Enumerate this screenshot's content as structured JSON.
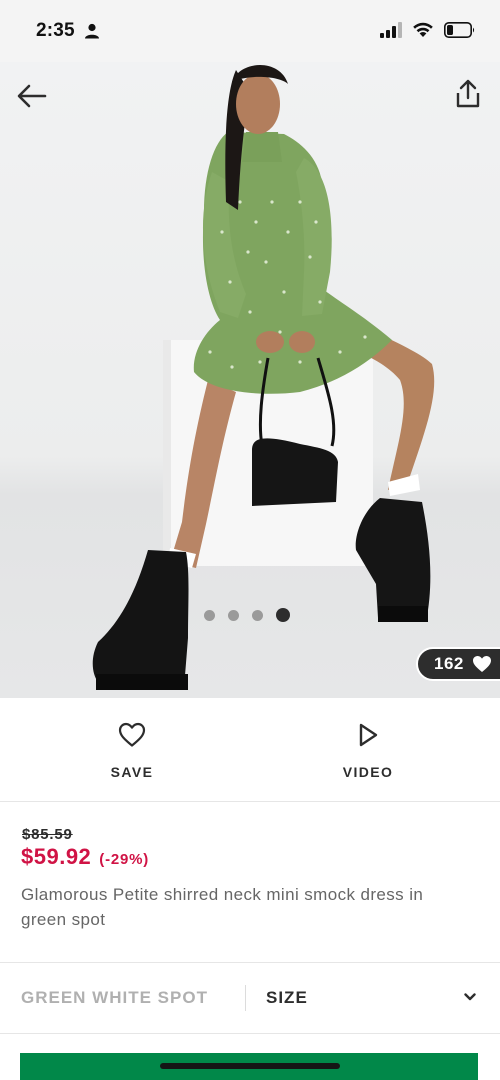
{
  "status_bar": {
    "time": "2:35"
  },
  "product": {
    "image_dots": 4,
    "active_dot": 4,
    "likes": "162",
    "actions": {
      "save_label": "SAVE",
      "video_label": "VIDEO"
    },
    "was_price": "$85.59",
    "now_price": "$59.92",
    "discount": "(-29%)",
    "name": "Glamorous Petite shirred neck mini smock dress in green spot",
    "colour": "GREEN WHITE SPOT",
    "size_label": "SIZE"
  },
  "colors": {
    "sale_price": "#d01345",
    "add_to_bag": "#018849",
    "text": "#2d2d2d",
    "muted": "#b0b0b0"
  },
  "icons": [
    "person-icon",
    "signal-icon",
    "wifi-icon",
    "battery-icon",
    "back-arrow-icon",
    "share-icon",
    "heart-icon",
    "play-icon",
    "chevron-down-icon"
  ]
}
